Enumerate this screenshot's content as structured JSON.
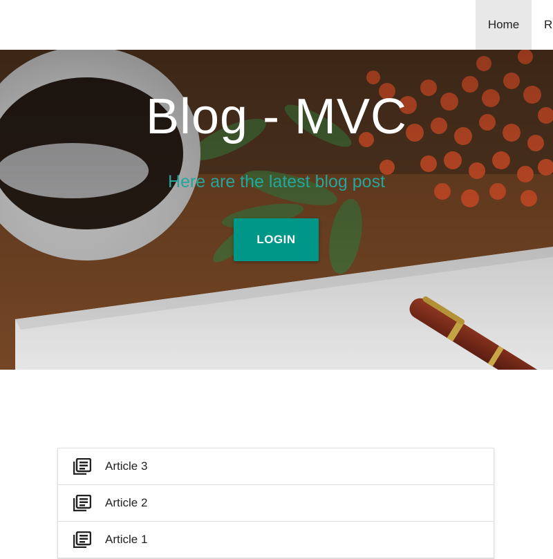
{
  "nav": {
    "items": [
      {
        "label": "Home",
        "active": true
      },
      {
        "label": "Re",
        "active": false
      }
    ]
  },
  "hero": {
    "title": "Blog - MVC",
    "subtitle": "Here are the latest blog post",
    "button_label": "LOGIN",
    "accent": "#009688",
    "subtitle_color": "#26a69a"
  },
  "articles": {
    "icon": "article-icon",
    "items": [
      {
        "label": "Article 3"
      },
      {
        "label": "Article 2"
      },
      {
        "label": "Article 1"
      }
    ]
  }
}
